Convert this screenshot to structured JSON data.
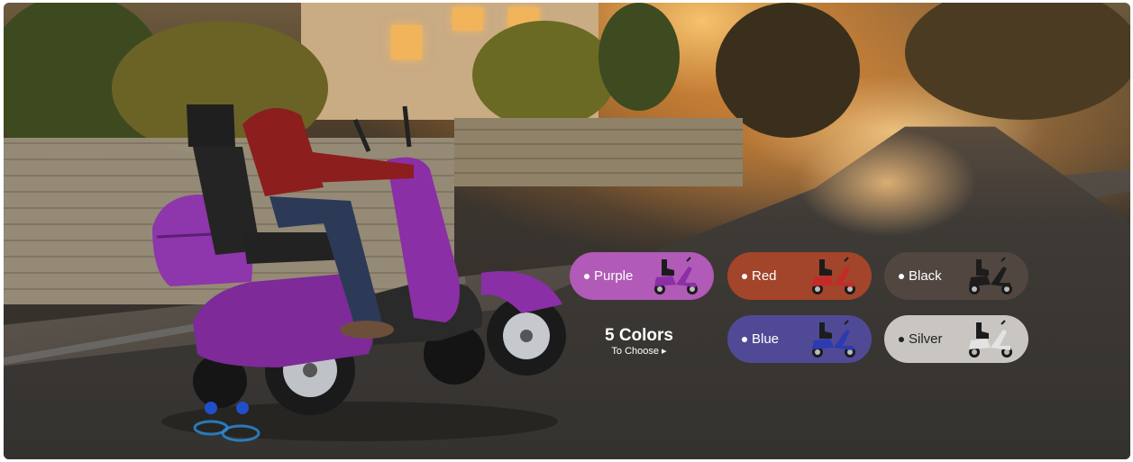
{
  "colors_heading": "5 Colors",
  "colors_subheading": "To Choose ▸",
  "color_options": [
    {
      "label": "Purple",
      "pill_color": "#b15ab7",
      "scooter_color": "#8a2fa6"
    },
    {
      "label": "Red",
      "pill_color": "#a2452a",
      "scooter_color": "#c52a2a"
    },
    {
      "label": "Black",
      "pill_color": "#514640",
      "scooter_color": "#1d1d1d"
    },
    {
      "label": "Blue",
      "pill_color": "#504a96",
      "scooter_color": "#2b3bb0"
    },
    {
      "label": "Silver",
      "pill_color": "#c9c6c2",
      "scooter_color": "#e3e3e3"
    }
  ]
}
